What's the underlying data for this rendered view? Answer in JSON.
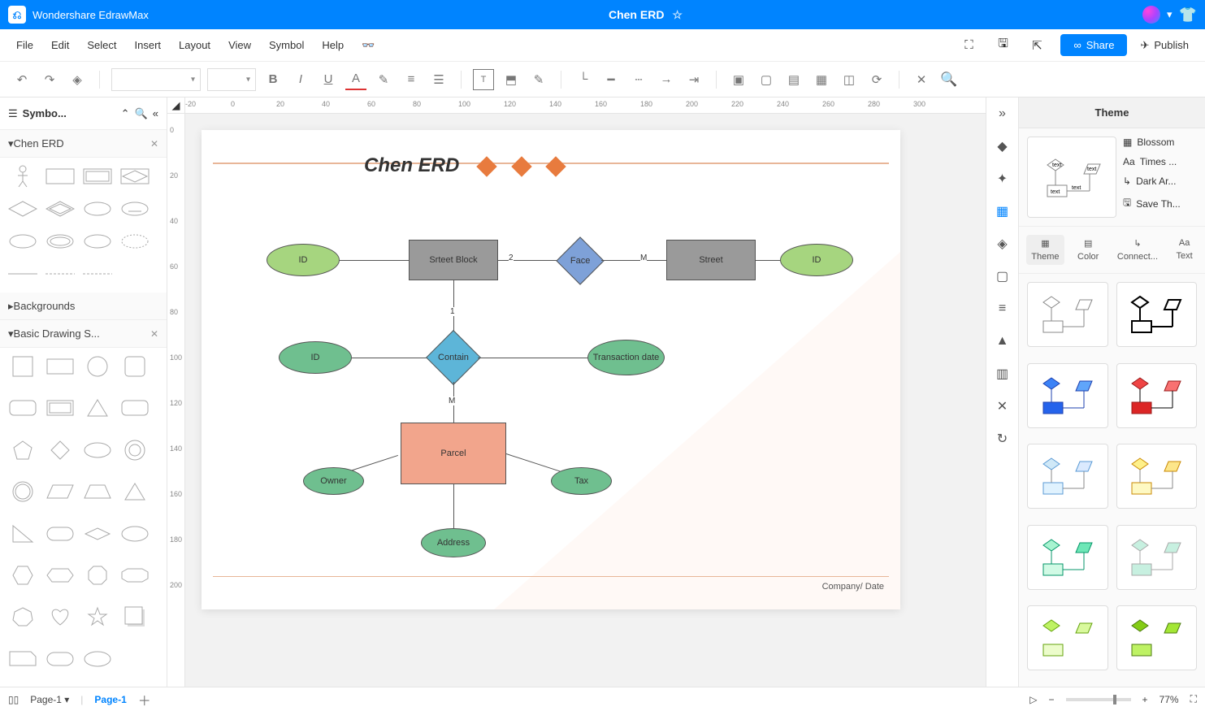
{
  "app": {
    "name": "Wondershare EdrawMax",
    "doc_title": "Chen ERD"
  },
  "menu": {
    "file": "File",
    "edit": "Edit",
    "select": "Select",
    "insert": "Insert",
    "layout": "Layout",
    "view": "View",
    "symbol": "Symbol",
    "help": "Help",
    "share": "Share",
    "publish": "Publish"
  },
  "left_panel": {
    "title": "Symbo...",
    "lib1": "Chen ERD",
    "backgrounds": "Backgrounds",
    "lib2": "Basic Drawing S..."
  },
  "diagram": {
    "title": "Chen ERD",
    "footer": "Company/ Date",
    "nodes": {
      "street_block": "Srteet Block",
      "face": "Face",
      "street": "Street",
      "id1": "ID",
      "id2": "ID",
      "id3": "ID",
      "contain": "Contain",
      "transaction": "Transaction date",
      "parcel": "Parcel",
      "owner": "Owner",
      "tax": "Tax",
      "address": "Address"
    },
    "labels": {
      "two": "2",
      "m1": "M",
      "one": "1",
      "m2": "M"
    }
  },
  "right_panel": {
    "header": "Theme",
    "opts": {
      "blossom": "Blossom",
      "font": "Times ...",
      "arrow": "Dark Ar...",
      "save": "Save Th..."
    },
    "tabs": {
      "theme": "Theme",
      "color": "Color",
      "connector": "Connect...",
      "text": "Text"
    }
  },
  "ruler": {
    "h": [
      "-20",
      "0",
      "20",
      "40",
      "60",
      "80",
      "100",
      "120",
      "140",
      "160",
      "180",
      "200",
      "220",
      "240",
      "260",
      "280",
      "300"
    ],
    "v": [
      "0",
      "20",
      "40",
      "60",
      "80",
      "100",
      "120",
      "140",
      "160",
      "180",
      "200"
    ]
  },
  "status": {
    "page_selector": "Page-1",
    "page_tab": "Page-1",
    "zoom": "77%"
  }
}
